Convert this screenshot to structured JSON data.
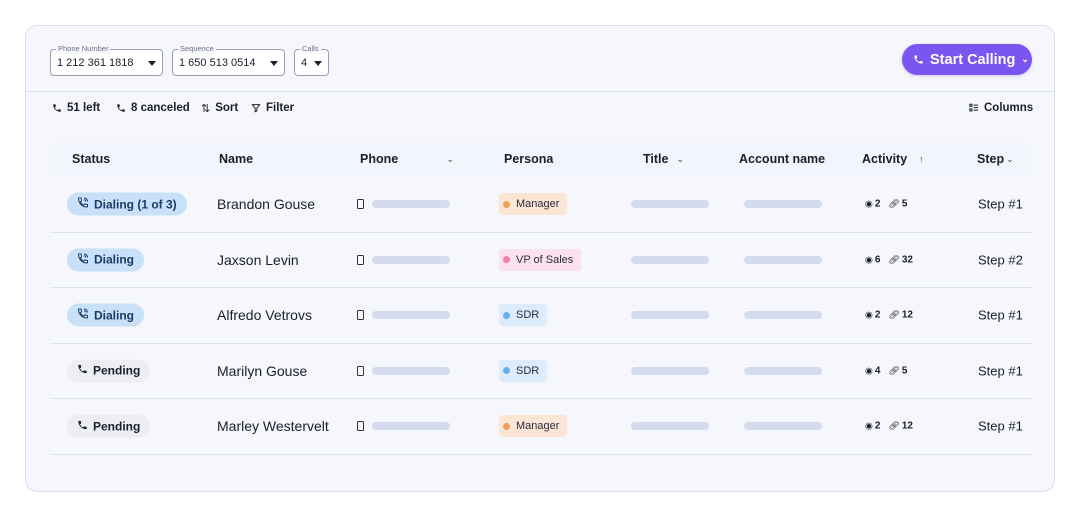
{
  "header": {
    "phone_number": {
      "legend": "Phone Number",
      "value": "1 212 361 1818"
    },
    "sequence": {
      "legend": "Sequence",
      "value": "1 650 513 0514"
    },
    "calls": {
      "legend": "Calls",
      "value": "4"
    },
    "start_button": {
      "label": "Start Calling",
      "icon": "phone-icon"
    }
  },
  "toolbar": {
    "left_label": "51 left",
    "canceled_label": "8 canceled",
    "sort_label": "Sort",
    "filter_label": "Filter",
    "columns_label": "Columns"
  },
  "columns": {
    "status": "Status",
    "name": "Name",
    "phone": "Phone",
    "persona": "Persona",
    "title": "Title",
    "account": "Account name",
    "activity": "Activity",
    "step": "Step"
  },
  "colors": {
    "accent": "#7a55f0",
    "dialing_bg": "#c8e0f8",
    "pending_bg": "#eceef4",
    "manager_bg": "#fbe6d6",
    "manager_dot": "#f0a05a",
    "vp_bg": "#fbe2ee",
    "vp_dot": "#ec7eb0",
    "sdr_bg": "#dcecfb",
    "sdr_dot": "#6aaee8"
  },
  "rows": [
    {
      "status": "Dialing (1 of 3)",
      "status_type": "dialing",
      "name": "Brandon Gouse",
      "persona": "Manager",
      "persona_type": "manager",
      "views": "2",
      "links": "5",
      "step": "Step #1"
    },
    {
      "status": "Dialing",
      "status_type": "dialing",
      "name": "Jaxson Levin",
      "persona": "VP of Sales",
      "persona_type": "vp",
      "views": "6",
      "links": "32",
      "step": "Step #2"
    },
    {
      "status": "Dialing",
      "status_type": "dialing",
      "name": "Alfredo Vetrovs",
      "persona": "SDR",
      "persona_type": "sdr",
      "views": "2",
      "links": "12",
      "step": "Step #1"
    },
    {
      "status": "Pending",
      "status_type": "pending",
      "name": "Marilyn Gouse",
      "persona": "SDR",
      "persona_type": "sdr",
      "views": "4",
      "links": "5",
      "step": "Step #1"
    },
    {
      "status": "Pending",
      "status_type": "pending",
      "name": "Marley Westervelt",
      "persona": "Manager",
      "persona_type": "manager",
      "views": "2",
      "links": "12",
      "step": "Step #1"
    }
  ]
}
